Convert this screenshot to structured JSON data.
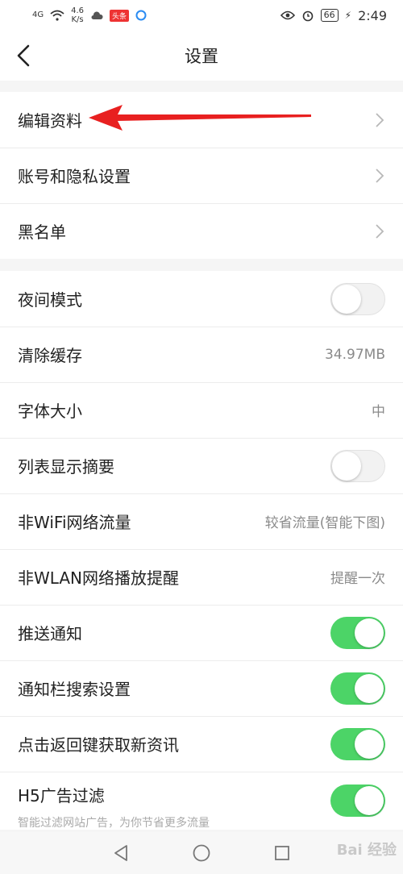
{
  "status_bar": {
    "signal": "4G",
    "speed_value": "4.6",
    "speed_unit": "K/s",
    "badge": "头条",
    "battery": "66",
    "time": "2:49"
  },
  "header": {
    "title": "设置"
  },
  "section1": [
    {
      "label": "编辑资料"
    },
    {
      "label": "账号和隐私设置"
    },
    {
      "label": "黑名单"
    }
  ],
  "section2": {
    "night_mode": {
      "label": "夜间模式",
      "on": false
    },
    "clear_cache": {
      "label": "清除缓存",
      "value": "34.97MB"
    },
    "font_size": {
      "label": "字体大小",
      "value": "中"
    },
    "list_summary": {
      "label": "列表显示摘要",
      "on": false
    },
    "non_wifi": {
      "label": "非WiFi网络流量",
      "value": "较省流量(智能下图)"
    },
    "non_wlan": {
      "label": "非WLAN网络播放提醒",
      "value": "提醒一次"
    },
    "push": {
      "label": "推送通知",
      "on": true
    },
    "notif_search": {
      "label": "通知栏搜索设置",
      "on": true
    },
    "back_refresh": {
      "label": "点击返回键获取新资讯",
      "on": true
    },
    "h5_filter": {
      "label": "H5广告过滤",
      "sub": "智能过滤网站广告，为你节省更多流量",
      "on": true
    }
  },
  "watermark": "Bai 经验",
  "colors": {
    "toggle_on": "#4cd467",
    "arrow": "#e82020"
  }
}
